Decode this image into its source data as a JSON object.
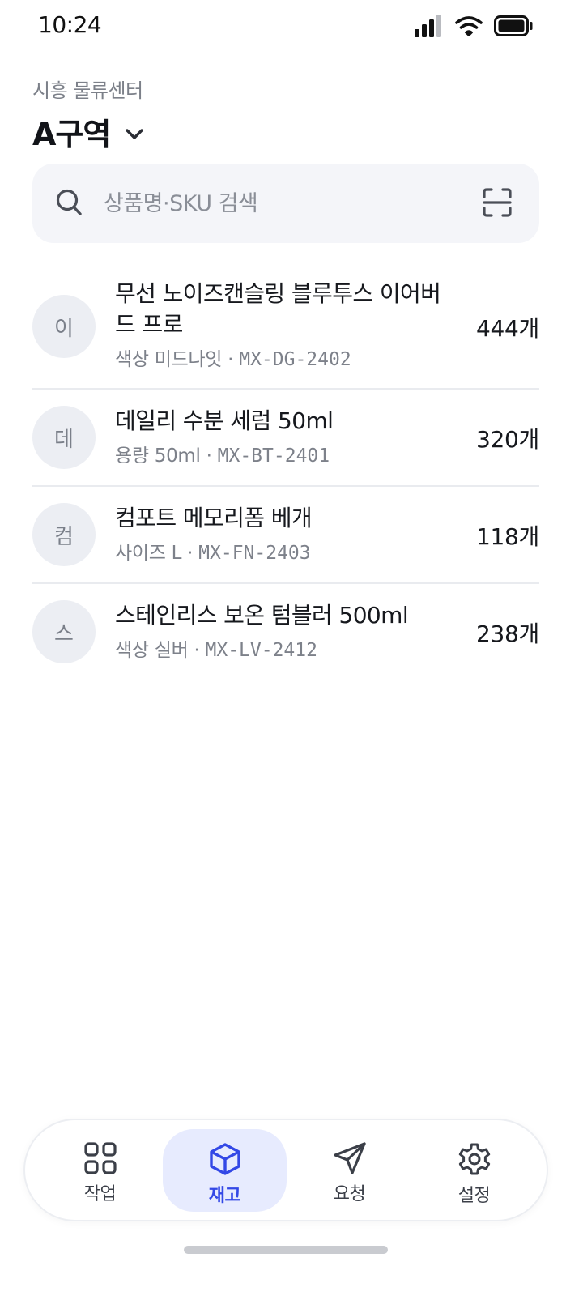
{
  "status_bar": {
    "time": "10:24",
    "icons": [
      "signal-icon",
      "wifi-icon",
      "battery-icon"
    ]
  },
  "header": {
    "subtitle": "시흥 물류센터",
    "title": "A구역"
  },
  "search": {
    "placeholder": "상품명·SKU 검색",
    "value": ""
  },
  "items": [
    {
      "avatar": "이",
      "name": "무선 노이즈캔슬링 블루투스 이어버드 프로",
      "option": "색상 미드나잇",
      "sku": "MX-DG-2402",
      "qty": "444개"
    },
    {
      "avatar": "데",
      "name": "데일리 수분 세럼 50ml",
      "option": "용량 50ml",
      "sku": "MX-BT-2401",
      "qty": "320개"
    },
    {
      "avatar": "컴",
      "name": "컴포트 메모리폼 베개",
      "option": "사이즈 L",
      "sku": "MX-FN-2403",
      "qty": "118개"
    },
    {
      "avatar": "스",
      "name": "스테인리스 보온 텀블러 500ml",
      "option": "색상 실버",
      "sku": "MX-LV-2412",
      "qty": "238개"
    }
  ],
  "separator": " · ",
  "tabbar": {
    "tabs": [
      {
        "label": "작업",
        "icon": "grid-icon",
        "active": false
      },
      {
        "label": "재고",
        "icon": "box-icon",
        "active": true
      },
      {
        "label": "요청",
        "icon": "send-icon",
        "active": false
      },
      {
        "label": "설정",
        "icon": "gear-icon",
        "active": false
      }
    ]
  },
  "colors": {
    "accent": "#3348e6",
    "accent_bg": "#e7ebfe",
    "search_bg": "#f4f5f9",
    "avatar_bg": "#eceef3",
    "muted_text": "#7d818a"
  }
}
